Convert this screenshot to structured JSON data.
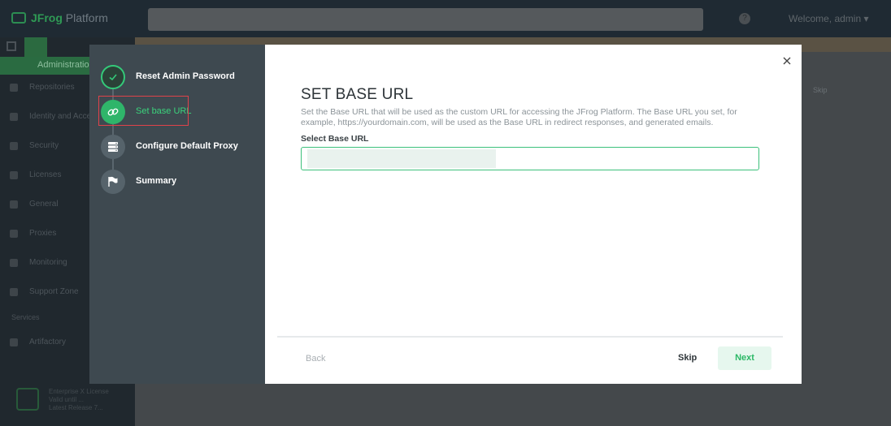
{
  "app": {
    "logo_brand": "JFrog",
    "logo_product": "Platform",
    "welcome": "Welcome, admin",
    "help_glyph": "?"
  },
  "leftnav": {
    "admin_label": "Administration",
    "items": [
      {
        "label": "Repositories",
        "icon": "repositories-icon"
      },
      {
        "label": "Identity and Access",
        "icon": "user-icon"
      },
      {
        "label": "Security",
        "icon": "shield-icon"
      },
      {
        "label": "Licenses",
        "icon": "license-icon"
      },
      {
        "label": "General",
        "icon": "list-icon"
      },
      {
        "label": "Proxies",
        "icon": "proxy-icon"
      },
      {
        "label": "Monitoring",
        "icon": "monitoring-icon"
      },
      {
        "label": "Support Zone",
        "icon": "support-icon"
      }
    ],
    "services_label": "Services",
    "services_items": [
      {
        "label": "Artifactory",
        "icon": "artifactory-icon"
      }
    ],
    "footer_lines": [
      "Enterprise X License",
      "Valid until ...",
      "Latest Release 7..."
    ]
  },
  "background": {
    "skip_ghost": "Skip"
  },
  "wizard": {
    "steps": [
      {
        "label": "Reset Admin Password",
        "state": "done",
        "icon": "check-icon"
      },
      {
        "label": "Set base URL",
        "state": "active",
        "icon": "link-icon"
      },
      {
        "label": "Configure Default Proxy",
        "state": "pending",
        "icon": "server-icon"
      },
      {
        "label": "Summary",
        "state": "pending",
        "icon": "flag-icon"
      }
    ],
    "title": "SET BASE URL",
    "description": "Set the Base URL that will be used as the custom URL for accessing the JFrog Platform. The Base URL you set, for example, https://yourdomain.com, will be used as the Base URL in redirect responses, and generated emails.",
    "field_label": "Select Base URL",
    "field_value": "",
    "back_label": "Back",
    "skip_label": "Skip",
    "next_label": "Next"
  },
  "colors": {
    "accent": "#2fb56a",
    "highlight": "#e0424a",
    "modal_sidebar": "#3e4950"
  }
}
